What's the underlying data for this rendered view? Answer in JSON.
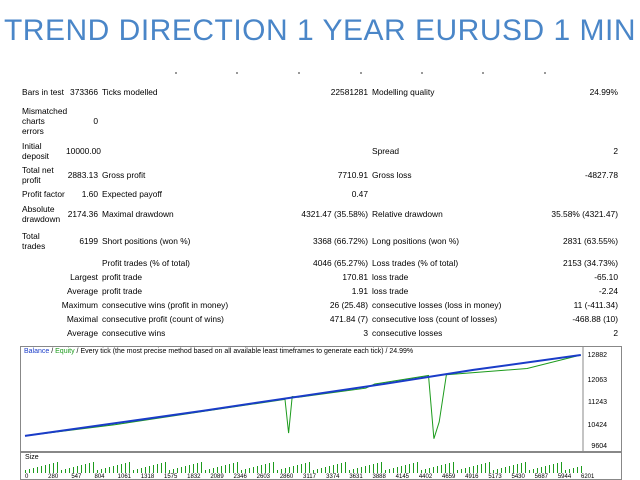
{
  "title": "TREND DIRECTION 1 YEAR EURUSD 1 MIN",
  "report": {
    "bars_in_test_label": "Bars in test",
    "bars_in_test": "373366",
    "ticks_modelled_label": "Ticks modelled",
    "ticks_modelled": "22581281",
    "modelling_quality_label": "Modelling quality",
    "modelling_quality": "24.99%",
    "mismatched_label": "Mismatched charts errors",
    "mismatched": "0",
    "initial_deposit_label": "Initial deposit",
    "initial_deposit": "10000.00",
    "spread_label": "Spread",
    "spread": "2",
    "total_net_profit_label": "Total net profit",
    "total_net_profit": "2883.13",
    "gross_profit_label": "Gross profit",
    "gross_profit": "7710.91",
    "gross_loss_label": "Gross loss",
    "gross_loss": "-4827.78",
    "profit_factor_label": "Profit factor",
    "profit_factor": "1.60",
    "expected_payoff_label": "Expected payoff",
    "expected_payoff": "0.47",
    "absolute_drawdown_label": "Absolute drawdown",
    "absolute_drawdown": "2174.36",
    "maximal_drawdown_label": "Maximal drawdown",
    "maximal_drawdown": "4321.47 (35.58%)",
    "relative_drawdown_label": "Relative drawdown",
    "relative_drawdown": "35.58% (4321.47)",
    "total_trades_label": "Total trades",
    "total_trades": "6199",
    "short_positions_label": "Short positions (won %)",
    "short_positions": "3368 (66.72%)",
    "long_positions_label": "Long positions (won %)",
    "long_positions": "2831 (63.55%)",
    "profit_trades_label": "Profit trades (% of total)",
    "profit_trades": "4046 (65.27%)",
    "loss_trades_label": "Loss trades (% of total)",
    "loss_trades": "2153 (34.73%)",
    "largest_label": "Largest",
    "largest_profit_label": "profit trade",
    "largest_profit": "170.81",
    "largest_loss_label": "loss trade",
    "largest_loss": "-65.10",
    "average_label": "Average",
    "average_profit_label": "profit trade",
    "average_profit": "1.91",
    "average_loss_label": "loss trade",
    "average_loss": "-2.24",
    "maximum_label": "Maximum",
    "max_cons_wins_label": "consecutive wins (profit in money)",
    "max_cons_wins": "26 (25.48)",
    "max_cons_losses_label": "consecutive losses (loss in money)",
    "max_cons_losses": "11 (-411.34)",
    "maximal_label": "Maximal",
    "maximal_cons_profit_label": "consecutive profit (count of wins)",
    "maximal_cons_profit": "471.84 (7)",
    "maximal_cons_loss_label": "consecutive loss (count of losses)",
    "maximal_cons_loss": "-468.88 (10)",
    "average2_label": "Average",
    "avg_cons_wins_label": "consecutive wins",
    "avg_cons_wins": "3",
    "avg_cons_losses_label": "consecutive losses",
    "avg_cons_losses": "2"
  },
  "chart": {
    "legend_balance": "Balance",
    "legend_sep": " / ",
    "legend_equity": "Equity",
    "legend_rest": " / Every tick (the most precise method based on all available least timeframes to generate each tick) / 24.99%",
    "y_labels": [
      "12882",
      "12063",
      "11243",
      "10424",
      "9604"
    ],
    "size_label": "Size",
    "x_labels": [
      "0",
      "280",
      "547",
      "804",
      "1061",
      "1318",
      "1575",
      "1832",
      "2089",
      "2346",
      "2603",
      "2860",
      "3117",
      "3374",
      "3631",
      "3888",
      "4145",
      "4402",
      "4659",
      "4916",
      "5173",
      "5430",
      "5687",
      "5944",
      "6201"
    ],
    "colors": {
      "balance": "#1a3cc8",
      "equity": "#1c9b1c"
    }
  },
  "chart_data": {
    "type": "line",
    "title": "",
    "xlabel": "",
    "ylabel": "",
    "ylim": [
      9604,
      12882
    ],
    "xlim": [
      0,
      6201
    ],
    "series": [
      {
        "name": "Balance",
        "x": [
          0,
          1000,
          2000,
          3000,
          4000,
          5000,
          6199
        ],
        "values": [
          10000,
          10450,
          10900,
          11380,
          11850,
          12350,
          12883
        ]
      },
      {
        "name": "Equity",
        "x": [
          0,
          1000,
          2000,
          2900,
          2940,
          2980,
          3050,
          3800,
          3900,
          4500,
          4560,
          4620,
          4700,
          5600,
          6199
        ],
        "values": [
          10000,
          10400,
          10880,
          11300,
          10100,
          11400,
          11380,
          11700,
          11850,
          12150,
          9900,
          10500,
          12180,
          12400,
          12883
        ]
      }
    ]
  }
}
